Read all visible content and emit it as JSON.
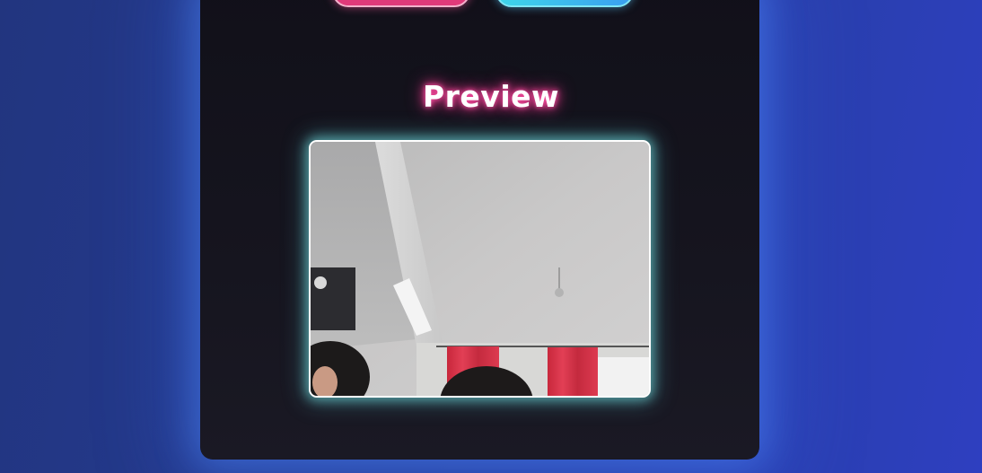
{
  "preview": {
    "title": "Preview"
  },
  "colors": {
    "background_start": "#22357f",
    "background_end": "#2e3fc0",
    "panel": "#14131d",
    "title_glow": "#ff3f98",
    "frame_glow": "#78e6e6",
    "button_pink": "#e03a7a",
    "button_cyan": "#3fd6ea"
  },
  "icons": {
    "camera_feed": "webcam-preview-image"
  }
}
